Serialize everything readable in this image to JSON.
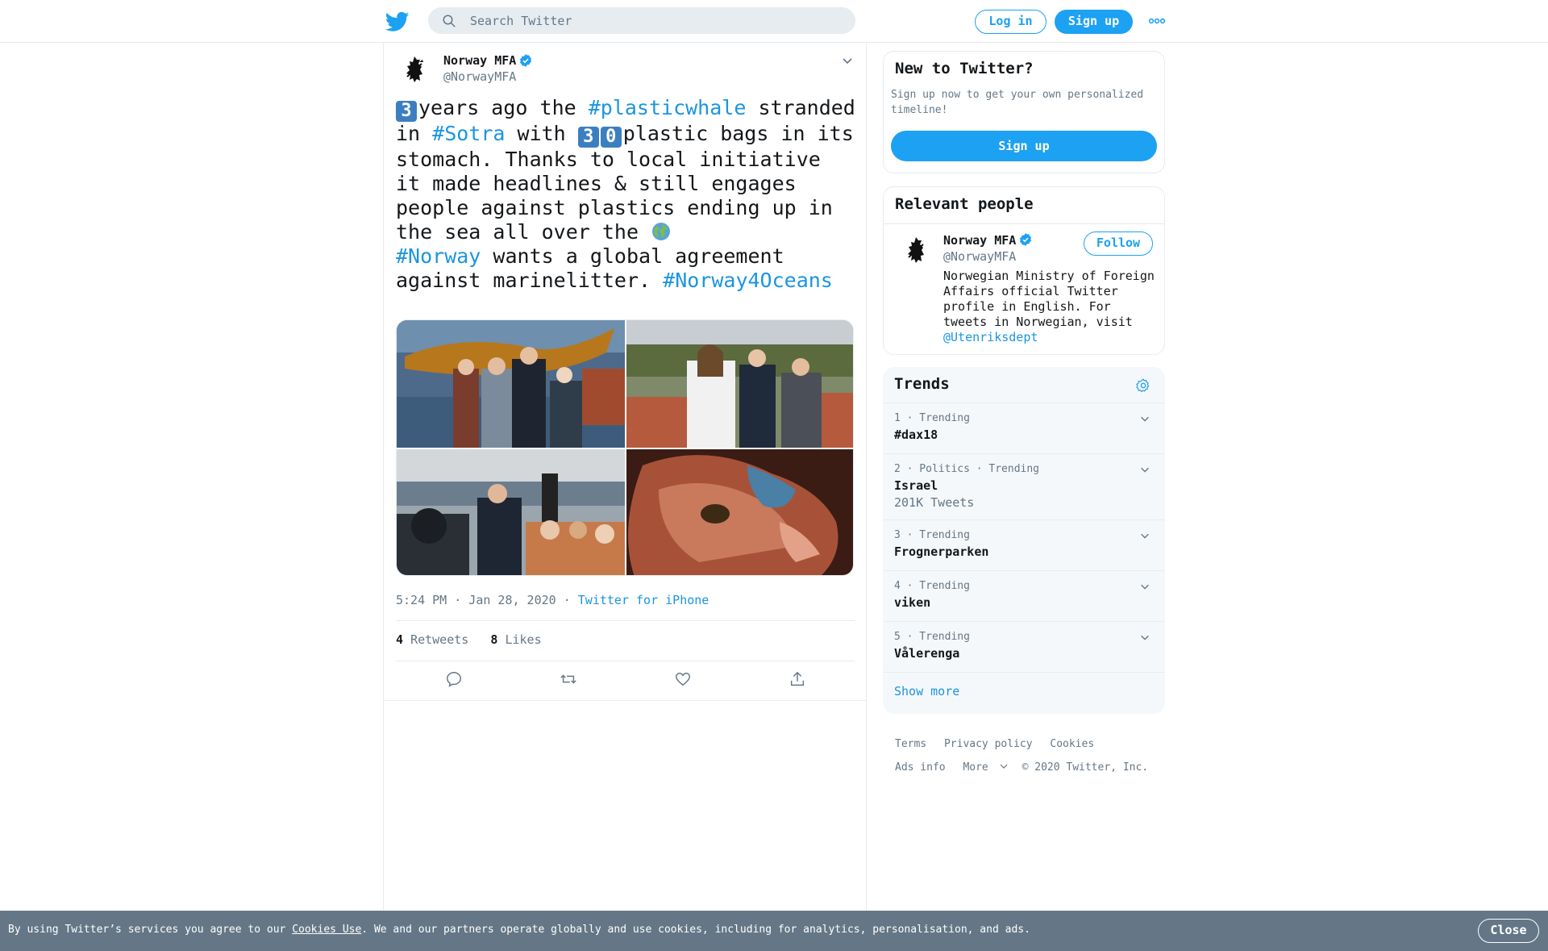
{
  "header": {
    "search_placeholder": "Search Twitter",
    "login_label": "Log in",
    "signup_label": "Sign up"
  },
  "tweet": {
    "author_name": "Norway MFA",
    "author_handle": "@NorwayMFA",
    "text": {
      "n1": "3",
      "p1": "years ago the ",
      "h1": "#plasticwhale",
      "p2": " stranded in ",
      "h2": "#Sotra",
      "p3": " with ",
      "n2a": "3",
      "n2b": "0",
      "p4": "plastic bags in its stomach. Thanks to local initiative it made headlines & still engages people against plastics ending up in the sea all over the ",
      "h3": "#Norway",
      "p5": " wants a global agreement against marinelitter. ",
      "h4": "#Norway4Oceans"
    },
    "time": "5:24 PM · Jan 28, 2020",
    "separator": "·",
    "source": "Twitter for iPhone",
    "retweets_count": "4",
    "retweets_label": "Retweets",
    "likes_count": "8",
    "likes_label": "Likes"
  },
  "sidebar": {
    "new_title": "New to Twitter?",
    "new_desc": "Sign up now to get your own personalized timeline!",
    "new_button": "Sign up",
    "relevant_title": "Relevant people",
    "person": {
      "name": "Norway MFA",
      "handle": "@NorwayMFA",
      "follow_label": "Follow",
      "bio": "Norwegian Ministry of Foreign Affairs official Twitter profile in English. For tweets in Norwegian, visit ",
      "bio_mention": "@Utenriksdept"
    },
    "trends_title": "Trends",
    "trends": [
      {
        "meta": "1 · Trending",
        "name": "#dax18",
        "count": ""
      },
      {
        "meta": "2 · Politics · Trending",
        "name": "Israel",
        "count": "201K Tweets"
      },
      {
        "meta": "3 · Trending",
        "name": "Frognerparken",
        "count": ""
      },
      {
        "meta": "4 · Trending",
        "name": "viken",
        "count": ""
      },
      {
        "meta": "5 · Trending",
        "name": "Vålerenga",
        "count": ""
      }
    ],
    "show_more": "Show more"
  },
  "footer": {
    "terms": "Terms",
    "privacy": "Privacy policy",
    "cookies": "Cookies",
    "ads_info": "Ads info",
    "more": "More",
    "copyright": "© 2020 Twitter, Inc."
  },
  "cookie_bar": {
    "text_before": "By using Twitter’s services you agree to our ",
    "link": "Cookies Use",
    "text_after": ". We and our partners operate globally and use cookies, including for analytics, personalisation, and ads.",
    "close_label": "Close"
  },
  "colors": {
    "brand_blue": "#1da1f2",
    "link_blue": "#1b95e0",
    "muted": "#657786",
    "cookie_bg": "#657786"
  }
}
